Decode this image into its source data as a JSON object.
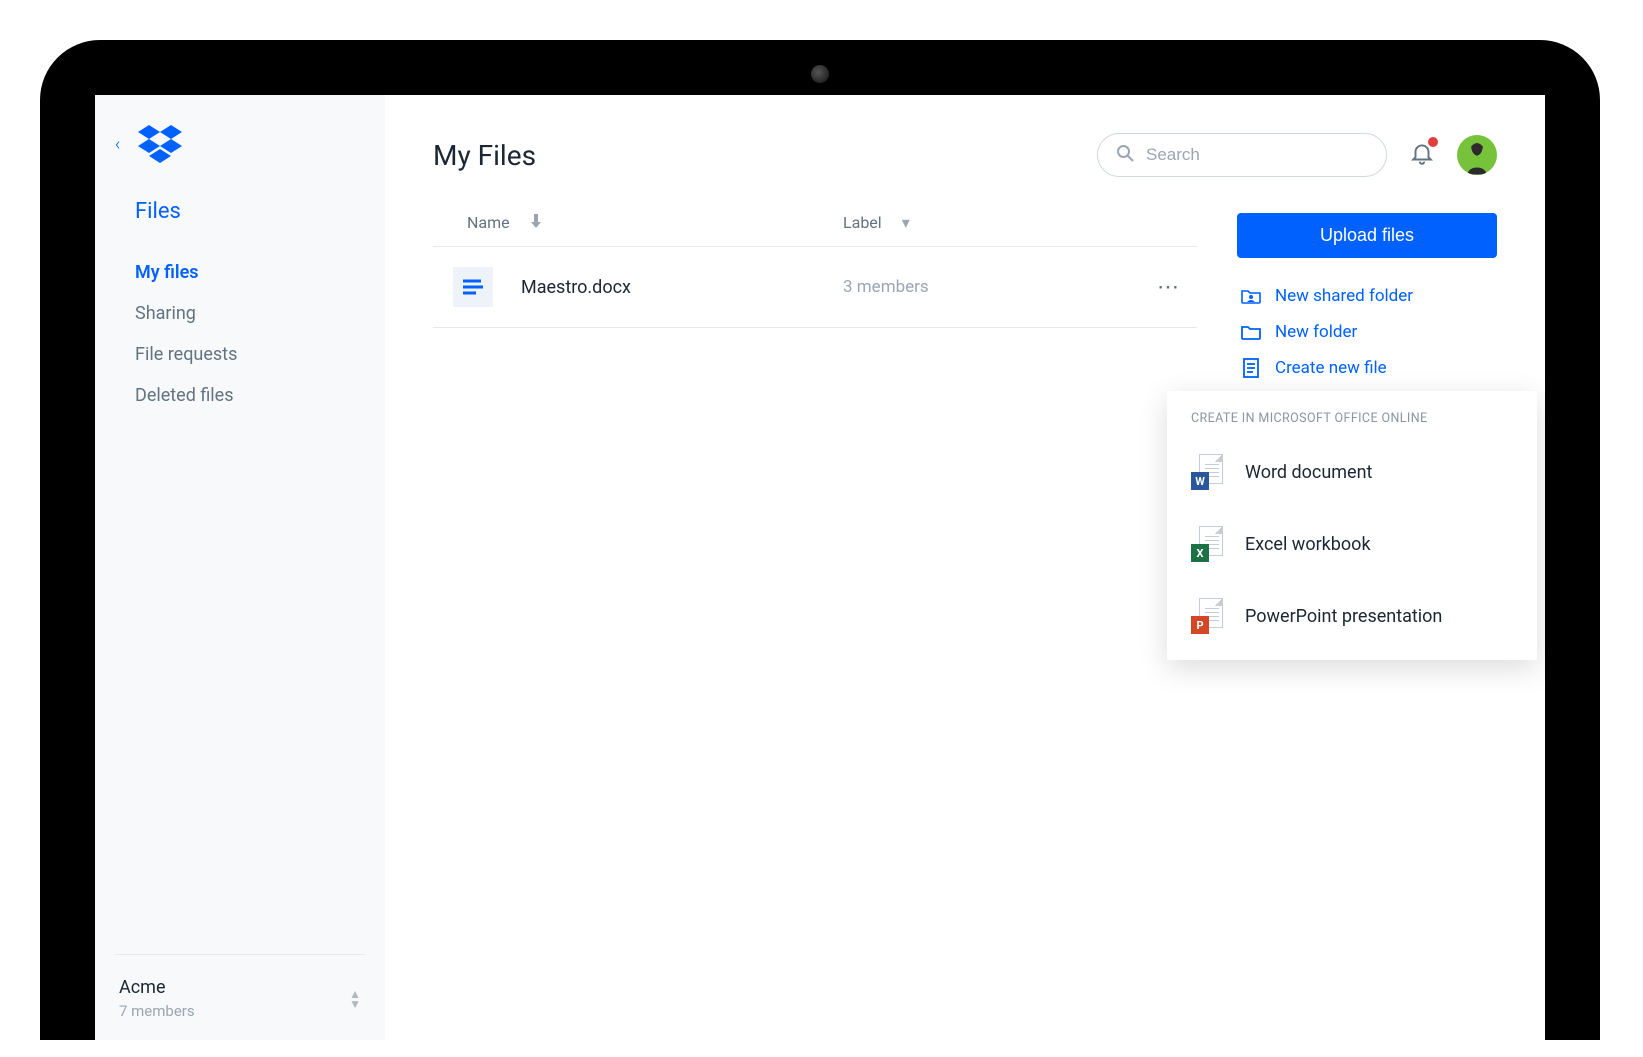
{
  "sidebar": {
    "section_title": "Files",
    "items": [
      {
        "label": "My files",
        "active": true
      },
      {
        "label": "Sharing",
        "active": false
      },
      {
        "label": "File requests",
        "active": false
      },
      {
        "label": "Deleted files",
        "active": false
      }
    ],
    "team": {
      "name": "Acme",
      "members_text": "7 members"
    }
  },
  "header": {
    "page_title": "My Files",
    "search_placeholder": "Search"
  },
  "table": {
    "columns": {
      "name": "Name",
      "label": "Label"
    },
    "rows": [
      {
        "name": "Maestro.docx",
        "label": "3 members"
      }
    ]
  },
  "actions": {
    "upload_label": "Upload files",
    "links": [
      {
        "label": "New shared folder",
        "icon": "shared-folder"
      },
      {
        "label": "New folder",
        "icon": "folder"
      },
      {
        "label": "Create new file",
        "icon": "file"
      }
    ]
  },
  "create_popup": {
    "header": "CREATE IN MICROSOFT OFFICE ONLINE",
    "items": [
      {
        "label": "Word document",
        "badge": "W",
        "badge_class": "badge-word"
      },
      {
        "label": "Excel workbook",
        "badge": "X",
        "badge_class": "badge-excel"
      },
      {
        "label": "PowerPoint presentation",
        "badge": "P",
        "badge_class": "badge-ppt"
      }
    ]
  }
}
